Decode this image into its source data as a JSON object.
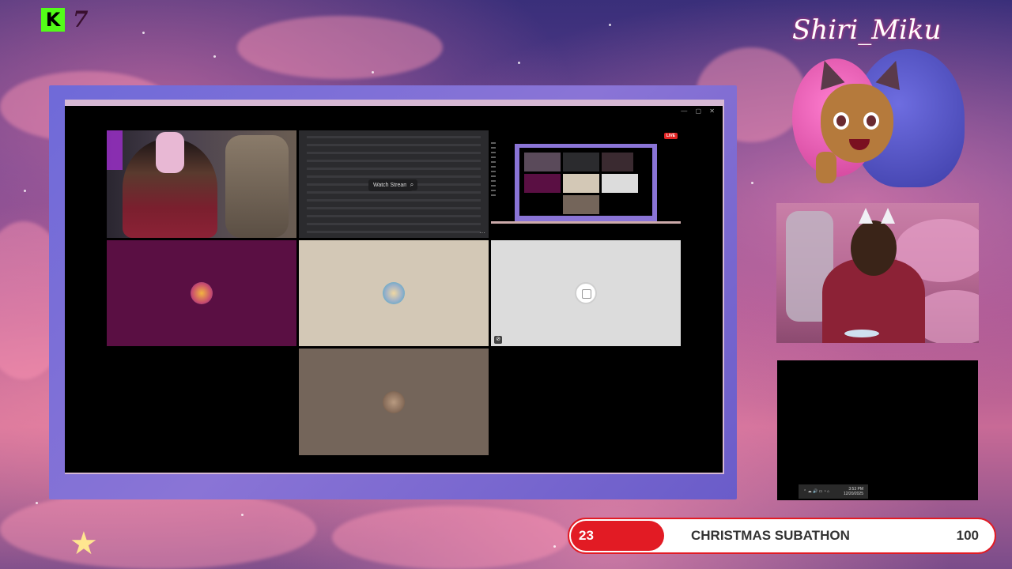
{
  "overlay": {
    "platform_logo": "K",
    "platform_number": "7",
    "brand_name": "Shiri_Miku"
  },
  "screen_share": {
    "watch_stream_label": "Watch Stream",
    "watch_icon": "magnifier-icon",
    "more_label": "···"
  },
  "mini_preview": {
    "live_badge": "LIVE"
  },
  "participants": [
    {
      "tile": "participant-tile-1",
      "color": "#5a0f43"
    },
    {
      "tile": "participant-tile-2",
      "color": "#d3c8b6"
    },
    {
      "tile": "participant-tile-3",
      "color": "#dcdcdc"
    },
    {
      "tile": "participant-tile-4",
      "color": "#74655a"
    }
  ],
  "taskbar": {
    "icons": "⌃ ☁ 🔊 ▭ ◔ ⌂",
    "time": "3:53 PM",
    "date": "12/20/2025"
  },
  "subathon": {
    "count": "23",
    "title": "CHRISTMAS SUBATHON",
    "goal": "100",
    "accent": "#e21b24",
    "progress": 0.23
  }
}
